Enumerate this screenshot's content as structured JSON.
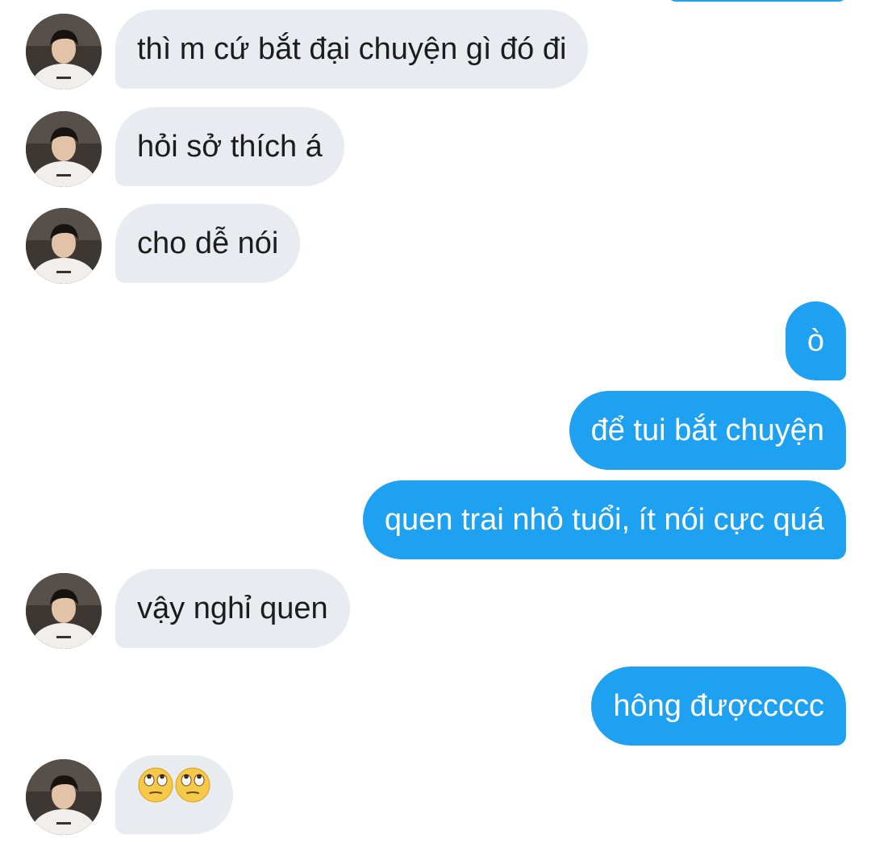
{
  "conversation": {
    "messages": [
      {
        "direction": "in",
        "text": "thì m cứ bắt đại chuyện gì đó đi"
      },
      {
        "direction": "in",
        "text": "hỏi sở thích á"
      },
      {
        "direction": "in",
        "text": "cho dễ nói"
      },
      {
        "direction": "out",
        "text": "ò"
      },
      {
        "direction": "out",
        "text": "để tui bắt chuyện"
      },
      {
        "direction": "out",
        "text": "quen trai nhỏ tuổi, ít nói cực quá"
      },
      {
        "direction": "in",
        "text": "vậy nghỉ quen"
      },
      {
        "direction": "out",
        "text": "hông đượccccc"
      },
      {
        "direction": "in",
        "emoji": [
          "face-with-rolling-eyes",
          "face-with-rolling-eyes"
        ]
      }
    ]
  },
  "colors": {
    "incoming_bubble": "#e8ebef",
    "outgoing_bubble": "#1ea1f1",
    "incoming_text": "#1c1c1c",
    "outgoing_text": "#ffffff"
  }
}
